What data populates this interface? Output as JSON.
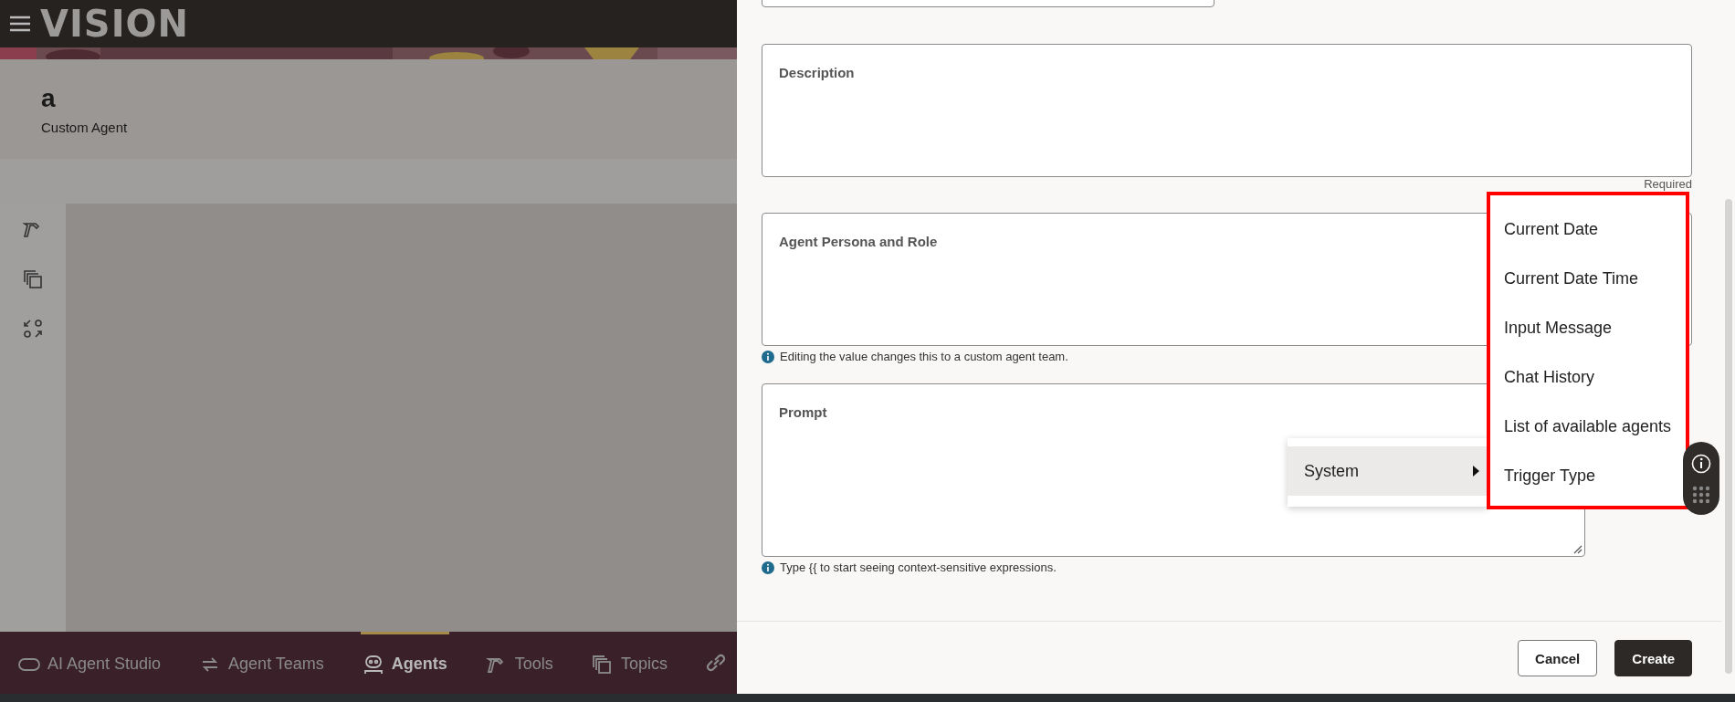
{
  "header": {
    "logo": "VISION"
  },
  "page": {
    "title": "a",
    "subtitle": "Custom Agent"
  },
  "bottom_nav": [
    {
      "label": "AI Agent Studio",
      "selected": false
    },
    {
      "label": "Agent Teams",
      "selected": false
    },
    {
      "label": "Agents",
      "selected": true
    },
    {
      "label": "Tools",
      "selected": false
    },
    {
      "label": "Topics",
      "selected": false
    }
  ],
  "form": {
    "fields": [
      {
        "label": "Description",
        "note": "Required"
      },
      {
        "label": "Agent Persona and Role",
        "hint": "Editing the value changes this to a custom agent team."
      },
      {
        "label": "Prompt",
        "hint": "Type {{ to start seeing context-sensitive expressions."
      }
    ]
  },
  "context_menu": {
    "items": [
      {
        "label": "System",
        "selected": true
      }
    ]
  },
  "submenu": {
    "items": [
      {
        "label": "Current Date"
      },
      {
        "label": "Current Date Time"
      },
      {
        "label": "Input Message"
      },
      {
        "label": "Chat History"
      },
      {
        "label": "List of available agents"
      },
      {
        "label": "Trigger Type"
      }
    ]
  },
  "buttons": [
    {
      "label": "Cancel",
      "kind": "secondary"
    },
    {
      "label": "Create",
      "kind": "primary"
    }
  ]
}
